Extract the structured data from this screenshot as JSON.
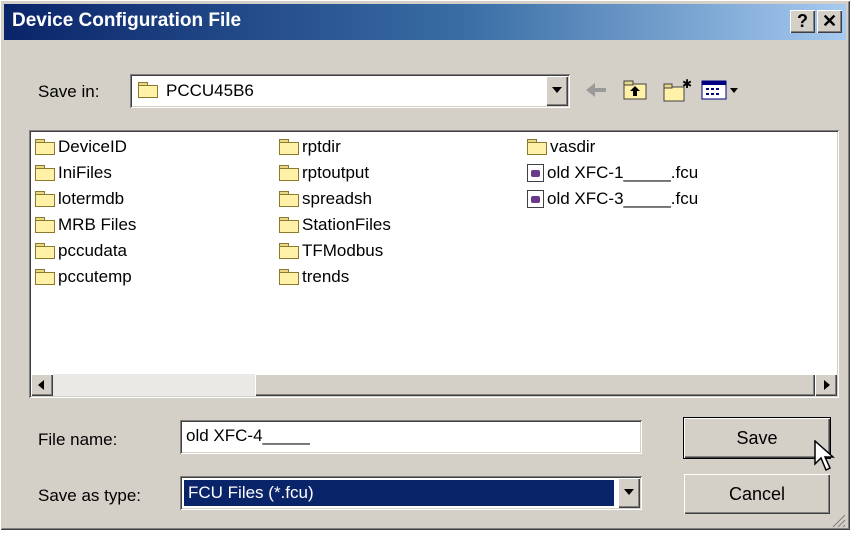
{
  "window": {
    "title": "Device Configuration File",
    "help_label": "?",
    "close_label": "✕"
  },
  "toolbar": {
    "save_in_label": "Save in:",
    "save_in_value": "PCCU45B6"
  },
  "files": {
    "col1": [
      "DeviceID",
      "IniFiles",
      "lotermdb",
      "MRB Files",
      "pccudata",
      "pccutemp"
    ],
    "col2": [
      "rptdir",
      "rptoutput",
      "spreadsh",
      "StationFiles",
      "TFModbus",
      "trends"
    ],
    "col3_folders": [
      "vasdir"
    ],
    "col3_files": [
      "old XFC-1_____.fcu",
      "old XFC-3_____.fcu"
    ]
  },
  "form": {
    "file_name_label": "File name:",
    "file_name_value": "old XFC-4_____",
    "save_as_type_label": "Save as type:",
    "save_as_type_value": "FCU Files (*.fcu)"
  },
  "buttons": {
    "save": "Save",
    "cancel": "Cancel"
  }
}
